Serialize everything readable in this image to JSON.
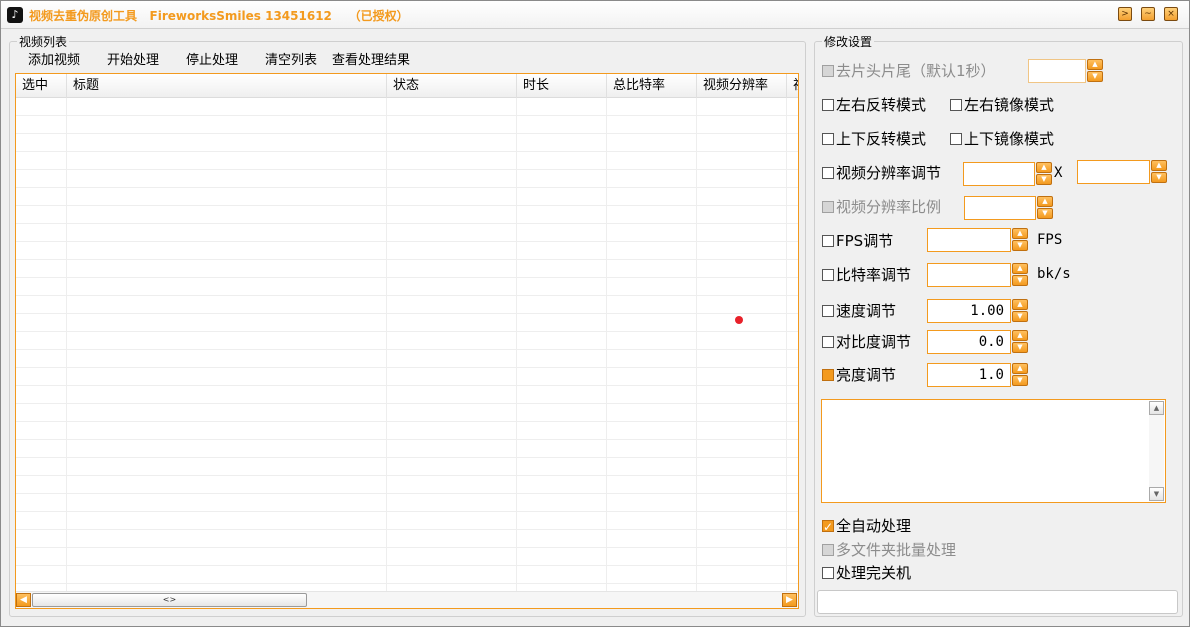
{
  "titlebar": {
    "title": "视频去重伪原创工具   FireworksSmiles 13451612    （已授权）",
    "app_icon": "tiktok-note-icon",
    "buttons": [
      ">",
      "~",
      "×"
    ]
  },
  "left_panel": {
    "group_title": "视频列表",
    "toolbar": {
      "add_video": "添加视频",
      "start": "开始处理",
      "stop": "停止处理",
      "clear": "清空列表",
      "view_results": "查看处理结果"
    },
    "columns": [
      "选中",
      "标题",
      "状态",
      "时长",
      "总比特率",
      "视频分辨率",
      "视"
    ],
    "rows": [],
    "scroll_thumb": "<>"
  },
  "right_panel": {
    "group_title": "修改设置",
    "trim": {
      "label": "去片头片尾（默认1秒）",
      "value": ""
    },
    "flip_lr": "左右反转模式",
    "mirror_lr": "左右镜像模式",
    "flip_ud": "上下反转模式",
    "mirror_ud": "上下镜像模式",
    "resolution": {
      "label": "视频分辨率调节",
      "width": "",
      "sep": "X",
      "height": ""
    },
    "ratio": {
      "label": "视频分辨率比例",
      "value": ""
    },
    "fps": {
      "label": "FPS调节",
      "value": "",
      "unit": "FPS"
    },
    "bitrate": {
      "label": "比特率调节",
      "value": "",
      "unit": "bk/s"
    },
    "speed": {
      "label": "速度调节",
      "value": "1.00"
    },
    "contrast": {
      "label": "对比度调节",
      "value": "0.0"
    },
    "brightness": {
      "label": "亮度调节",
      "value": "1.0"
    },
    "log_text": "",
    "auto_process": "全自动处理",
    "batch_folders": "多文件夹批量处理",
    "shutdown": "处理完关机",
    "status_text": ""
  },
  "colors": {
    "accent": "#f39a1e",
    "title_text": "#f39a1e",
    "dot": "#e8212a"
  }
}
